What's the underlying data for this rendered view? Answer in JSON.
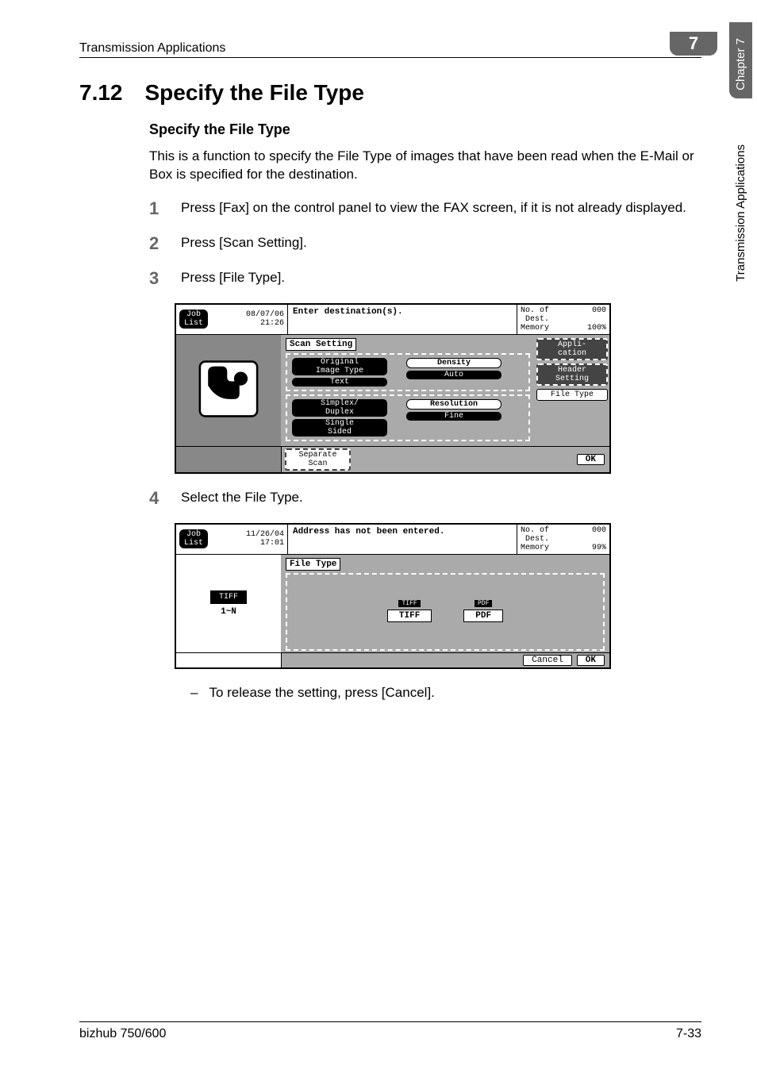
{
  "header": {
    "breadcrumb": "Transmission Applications",
    "chapter_badge": "7"
  },
  "sidebar": {
    "chapter": "Chapter 7",
    "section": "Transmission Applications"
  },
  "section": {
    "number": "7.12",
    "title": "Specify the File Type"
  },
  "subsection": {
    "title": "Specify the File Type",
    "intro": "This is a function to specify the File Type of images that have been read when the E-Mail or Box is specified for the destination."
  },
  "steps": {
    "s1": {
      "num": "1",
      "text": "Press [Fax] on the control panel to view the FAX screen, if it is not already displayed."
    },
    "s2": {
      "num": "2",
      "text": "Press [Scan Setting]."
    },
    "s3": {
      "num": "3",
      "text": "Press [File Type]."
    },
    "s4": {
      "num": "4",
      "text": "Select the File Type."
    }
  },
  "bullet": {
    "dash": "–",
    "text": "To release the setting, press [Cancel]."
  },
  "screen1": {
    "job_list": "Job\nList",
    "date": "08/07/06",
    "time": "21:26",
    "message": "Enter destination(s).",
    "dest_label": "No. of\nDest.",
    "dest_count": "000",
    "mem_label": "Memory",
    "mem_value": "100%",
    "panel_title": "Scan Setting",
    "orig_lbl": "Original\nImage Type",
    "orig_val": "Text",
    "density_lbl": "Density",
    "density_val": "Auto",
    "duplex_lbl": "Simplex/\nDuplex",
    "duplex_val": "Single\nSided",
    "res_lbl": "Resolution",
    "res_val": "Fine",
    "side1": "Appli-\ncation",
    "side2": "Header\nSetting",
    "side3": "File Type",
    "sep_scan": "Separate\nScan",
    "ok": "OK"
  },
  "screen2": {
    "job_list": "Job\nList",
    "date": "11/26/04",
    "time": "17:01",
    "message": "Address has not been entered.",
    "dest_label": "No. of\nDest.",
    "dest_count": "000",
    "mem_label": "Memory",
    "mem_value": "99%",
    "panel_title": "File Type",
    "tiff_thumb": "TIFF",
    "tiff_caption": "1~N",
    "tiff_mini": "TIFF",
    "tiff_label": "TIFF",
    "pdf_mini": "PDF",
    "pdf_label": "PDF",
    "cancel": "Cancel",
    "ok": "OK"
  },
  "footer": {
    "model": "bizhub 750/600",
    "page": "7-33"
  }
}
